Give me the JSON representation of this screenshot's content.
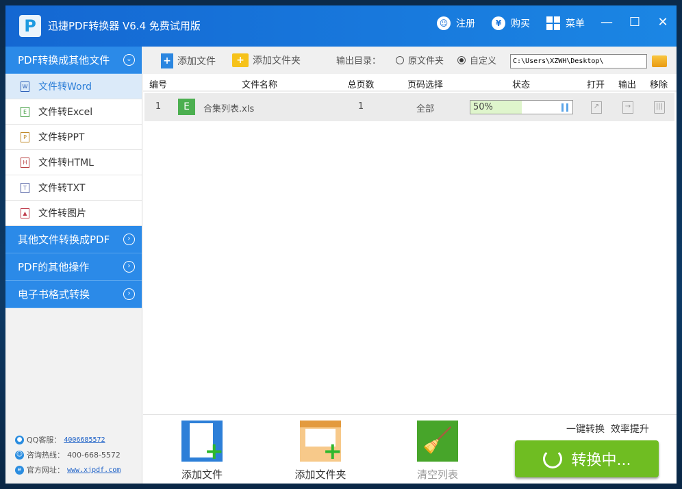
{
  "window": {
    "title": "迅捷PDF转换器 V6.4 免费试用版",
    "logo": "P",
    "register": "注册",
    "buy": "购买",
    "menu": "菜单"
  },
  "sidebar": {
    "sections": [
      {
        "label": "PDF转换成其他文件",
        "expanded": true
      },
      {
        "label": "其他文件转换成PDF"
      },
      {
        "label": "PDF的其他操作"
      },
      {
        "label": "电子书格式转换"
      }
    ],
    "items": [
      {
        "label": "文件转Word",
        "icon": "W",
        "selected": true
      },
      {
        "label": "文件转Excel",
        "icon": "E"
      },
      {
        "label": "文件转PPT",
        "icon": "P"
      },
      {
        "label": "文件转HTML",
        "icon": "H"
      },
      {
        "label": "文件转TXT",
        "icon": "T"
      },
      {
        "label": "文件转图片",
        "icon": "image"
      }
    ],
    "contact": {
      "qq_label": "QQ客服：",
      "qq": "4006685572",
      "hotline_label": "咨询热线：",
      "hotline": "400-668-5572",
      "site_label": "官方网址：",
      "site": "www.xjpdf.com"
    }
  },
  "toolbar": {
    "add_file": "添加文件",
    "add_folder": "添加文件夹",
    "output_label": "输出目录：",
    "opt_original": "原文件夹",
    "opt_custom": "自定义",
    "selected_option": "自定义",
    "output_path": "C:\\Users\\XZWH\\Desktop\\"
  },
  "table": {
    "headers": [
      "编号",
      "文件名称",
      "总页数",
      "页码选择",
      "状态",
      "打开",
      "输出",
      "移除"
    ],
    "rows": [
      {
        "no": "1",
        "type": "E",
        "name": "合集列表.xls",
        "pages": "1",
        "range": "全部",
        "progress_text": "50%",
        "progress": 50
      }
    ]
  },
  "bottom": {
    "add_file": "添加文件",
    "add_folder": "添加文件夹",
    "clear": "清空列表",
    "slogan": "一键转换  效率提升",
    "convert": "转换中..."
  },
  "colors": {
    "accent": "#2b8ae8",
    "convert": "#6fbd22"
  }
}
